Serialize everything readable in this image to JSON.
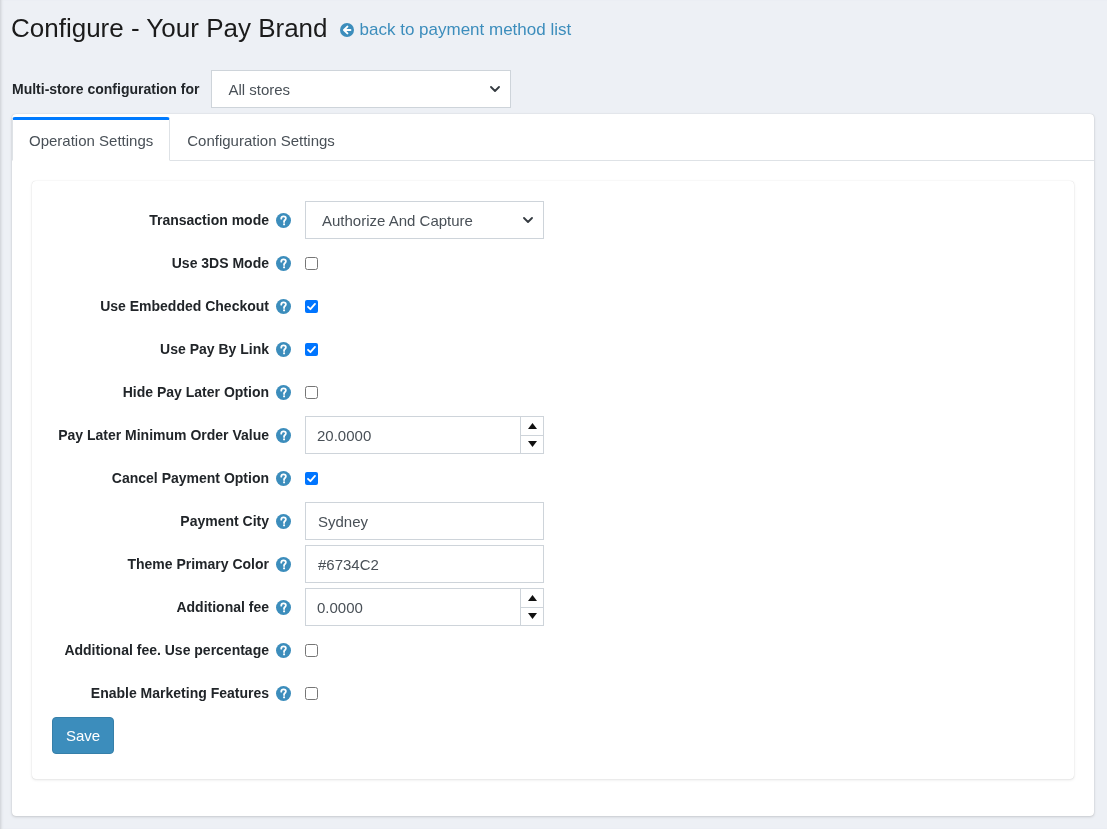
{
  "page": {
    "title": "Configure - Your Pay Brand",
    "back_link": "back to payment method list"
  },
  "store_scope": {
    "label": "Multi-store configuration for",
    "value": "All stores"
  },
  "tabs": [
    {
      "label": "Operation Settings",
      "selected": true
    },
    {
      "label": "Configuration Settings",
      "selected": false
    }
  ],
  "fields": [
    {
      "kind": "select",
      "label": "Transaction mode",
      "value": "Authorize And Capture"
    },
    {
      "kind": "checkbox",
      "label": "Use 3DS Mode",
      "checked": false
    },
    {
      "kind": "checkbox",
      "label": "Use Embedded Checkout",
      "checked": true
    },
    {
      "kind": "checkbox",
      "label": "Use Pay By Link",
      "checked": true
    },
    {
      "kind": "checkbox",
      "label": "Hide Pay Later Option",
      "checked": false
    },
    {
      "kind": "number",
      "label": "Pay Later Minimum Order Value",
      "value": "20.0000"
    },
    {
      "kind": "checkbox",
      "label": "Cancel Payment Option",
      "checked": true
    },
    {
      "kind": "text",
      "label": "Payment City",
      "value": "Sydney"
    },
    {
      "kind": "text",
      "label": "Theme Primary Color",
      "value": "#6734C2"
    },
    {
      "kind": "number",
      "label": "Additional fee",
      "value": "0.0000"
    },
    {
      "kind": "checkbox",
      "label": "Additional fee. Use percentage",
      "checked": false
    },
    {
      "kind": "checkbox",
      "label": "Enable Marketing Features",
      "checked": false
    }
  ],
  "save_button": "Save"
}
